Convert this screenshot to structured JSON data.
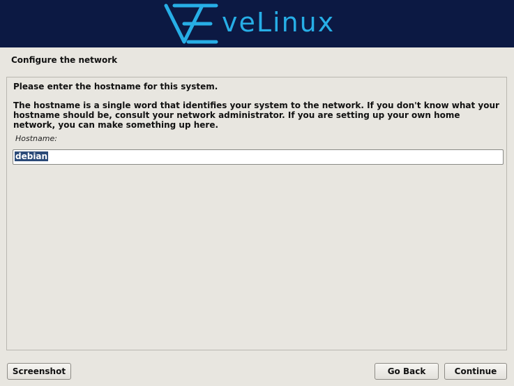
{
  "banner": {
    "logo_text": "veLinux",
    "logo_icon": "evelinux-e-logo-icon",
    "accent_color": "#27aee6",
    "background_color": "#0c1943"
  },
  "step_title": "Configure the network",
  "panel": {
    "prompt": "Please enter the hostname for this system.",
    "description": "The hostname is a single word that identifies your system to the network. If you don't know what your hostname should be, consult your network administrator. If you are setting up your own home network, you can make something up here.",
    "field_label": "Hostname:",
    "hostname_value": "debian"
  },
  "buttons": {
    "screenshot": "Screenshot",
    "go_back": "Go Back",
    "continue": "Continue"
  }
}
